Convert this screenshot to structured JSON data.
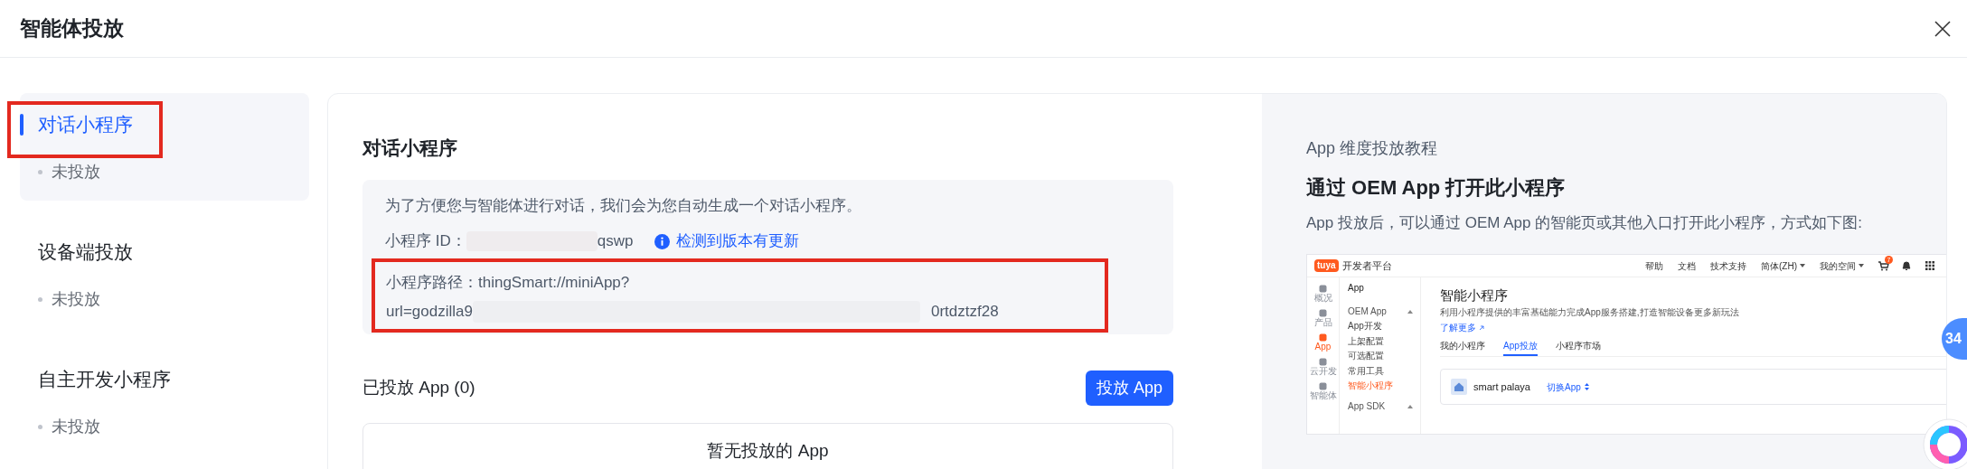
{
  "dialog": {
    "title": "智能体投放"
  },
  "sidebar": {
    "items": [
      {
        "label": "对话小程序",
        "status": "未投放",
        "selected": true,
        "highlighted": true
      },
      {
        "label": "设备端投放",
        "status": "未投放",
        "selected": false,
        "highlighted": false
      },
      {
        "label": "自主开发小程序",
        "status": "未投放",
        "selected": false,
        "highlighted": false
      }
    ]
  },
  "main": {
    "heading": "对话小程序",
    "info": {
      "intro": "为了方便您与智能体进行对话，我们会为您自动生成一个对话小程序。",
      "id_label": "小程序 ID：",
      "id_value": "qswp",
      "update_link": "检测到版本有更新",
      "path_label": "小程序路径：",
      "path_line1": "thingSmart://miniApp?",
      "path_prefix": "url=godzilla9",
      "path_suffix": "0rtdztzf28",
      "path_highlighted": true
    },
    "deployed_title": "已投放 App (0)",
    "deploy_button": "投放 App",
    "empty_text": "暂无投放的 App"
  },
  "tutorial": {
    "label": "App 维度投放教程",
    "title": "通过 OEM App 打开此小程序",
    "description": "App 投放后，可以通过 OEM App 的智能页或其他入口打开此小程序，方式如下图:",
    "screenshot": {
      "logo": "tuya",
      "platform": "开发者平台",
      "top_links": [
        {
          "label": "帮助",
          "dropdown": false
        },
        {
          "label": "文档",
          "dropdown": false
        },
        {
          "label": "技术支持",
          "dropdown": false
        },
        {
          "label": "简体(ZH)",
          "dropdown": true
        },
        {
          "label": "我的空间",
          "dropdown": true
        }
      ],
      "cart_badge": "7",
      "rail": [
        {
          "label": "概况",
          "selected": false
        },
        {
          "label": "产品",
          "selected": false
        },
        {
          "label": "App",
          "selected": true
        },
        {
          "label": "云开发",
          "selected": false
        },
        {
          "label": "智能体",
          "selected": false
        }
      ],
      "menu": [
        {
          "label": "App",
          "kind": "header",
          "selected": false
        },
        {
          "label": "OEM App",
          "kind": "group",
          "selected": false
        },
        {
          "label": "App开发",
          "kind": "item",
          "selected": false
        },
        {
          "label": "上架配置",
          "kind": "item",
          "selected": false
        },
        {
          "label": "可选配置",
          "kind": "item",
          "selected": false
        },
        {
          "label": "常用工具",
          "kind": "item",
          "selected": false
        },
        {
          "label": "智能小程序",
          "kind": "item",
          "selected": true
        },
        {
          "label": "App SDK",
          "kind": "group",
          "selected": false
        }
      ],
      "page_title": "智能小程序",
      "page_description": "利用小程序提供的丰富基础能力完成App服务搭建,打造智能设备更多新玩法",
      "learn_more": "了解更多",
      "tabs": [
        {
          "label": "我的小程序",
          "selected": false
        },
        {
          "label": "App投放",
          "selected": true
        },
        {
          "label": "小程序市场",
          "selected": false
        }
      ],
      "app_name": "smart palaya",
      "switch_app": "切换App"
    }
  },
  "floating_badge": "34"
}
